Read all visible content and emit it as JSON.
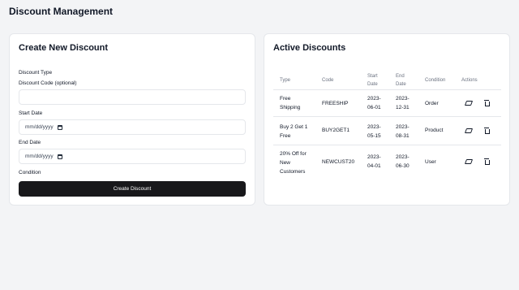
{
  "app": {
    "title": "Discount Management"
  },
  "create": {
    "title": "Create New Discount",
    "labels": {
      "discount_type": "Discount Type",
      "discount_code": "Discount Code (optional)",
      "start_date": "Start Date",
      "end_date": "End Date",
      "condition": "Condition"
    },
    "code_value": "",
    "start_date_placeholder": "mm/dd/yyyy",
    "end_date_placeholder": "mm/dd/yyyy",
    "submit_label": "Create Discount"
  },
  "active": {
    "title": "Active Discounts",
    "columns": {
      "type": "Type",
      "code": "Code",
      "start_date": "Start Date",
      "end_date": "End Date",
      "condition": "Condition",
      "actions": "Actions"
    },
    "rows": [
      {
        "type": "Free Shipping",
        "code": "FREESHIP",
        "start_date": "2023-06-01",
        "end_date": "2023-12-31",
        "condition": "Order"
      },
      {
        "type": "Buy 2 Get 1 Free",
        "code": "BUY2GET1",
        "start_date": "2023-05-15",
        "end_date": "2023-08-31",
        "condition": "Product"
      },
      {
        "type": "20% Off for New Customers",
        "code": "NEWCUST20",
        "start_date": "2023-04-01",
        "end_date": "2023-06-30",
        "condition": "User"
      }
    ],
    "action_icons": [
      "eraser-icon",
      "trash-icon"
    ]
  }
}
